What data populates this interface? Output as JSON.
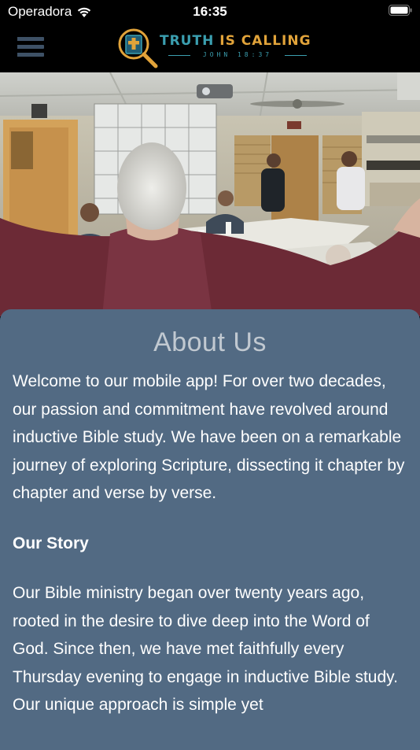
{
  "status_bar": {
    "carrier": "Operadora",
    "time": "16:35"
  },
  "header": {
    "logo_title_part1": "TRUTH",
    "logo_title_part2": "IS CALLING",
    "logo_subtitle": "JOHN 18:37",
    "icons": [
      "menu-icon",
      "bible-magnifier-logo-icon"
    ],
    "colors": {
      "teal": "#3b9fb0",
      "gold": "#e1a33a"
    }
  },
  "hero_image": {
    "description": "Bible study group meeting in a room"
  },
  "about": {
    "title": "About Us",
    "intro": "Welcome to our mobile app! For over two decades, our passion and commitment have revolved around inductive Bible study. We have been on a remarkable journey of exploring Scripture, dissecting it chapter by chapter and verse by verse.",
    "story_heading": "Our Story",
    "story_text": "Our Bible ministry began over twenty years ago, rooted in the desire to dive deep into the Word of God. Since then, we have met faithfully every Thursday evening to engage in inductive Bible study. Our unique approach is simple yet",
    "card_color": "#526a83"
  }
}
